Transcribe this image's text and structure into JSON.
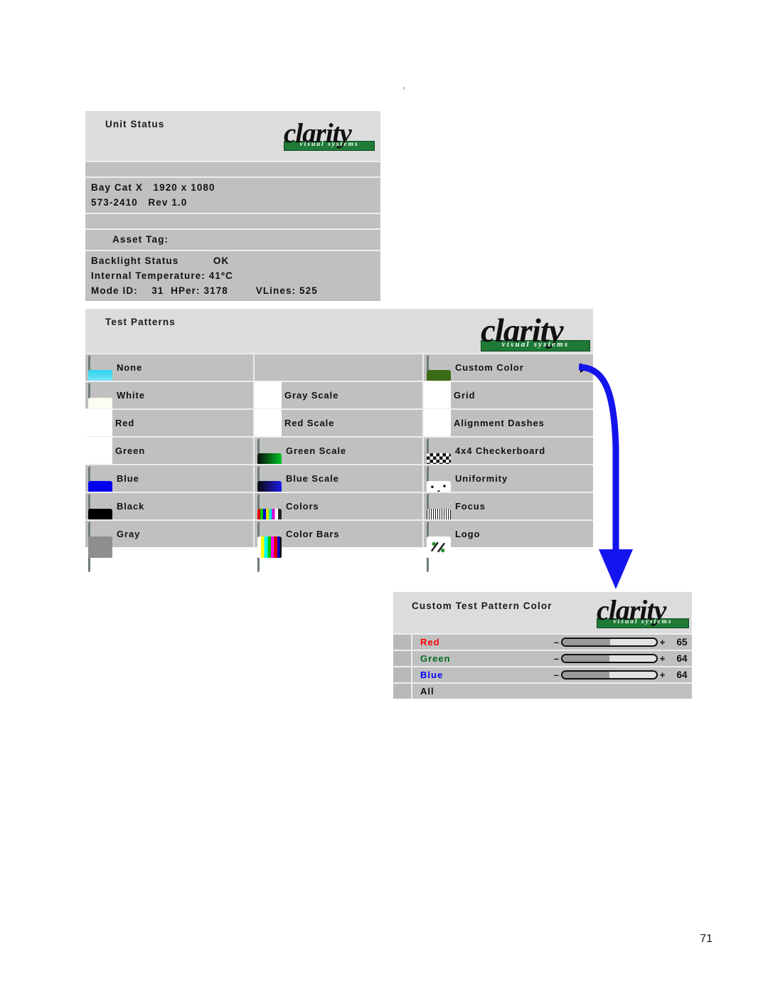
{
  "brand": {
    "word": "clarity",
    "tagline": "visual systems",
    "registered": "®"
  },
  "page": {
    "number": "71",
    "top_artifact": "ııı"
  },
  "unit_status": {
    "title": "Unit Status",
    "model_line": "Bay Cat X   1920 x 1080",
    "part_line": "573-2410   Rev 1.0",
    "asset_tag": "Asset Tag:",
    "backlight": "Backlight Status          OK",
    "temperature": "Internal Temperature: 41ºC",
    "mode_line": "Mode ID:    31  HPer: 3178        VLines: 525"
  },
  "test_patterns": {
    "title": "Test Patterns",
    "columns": [
      {
        "items": [
          {
            "label": "None",
            "icon": "photo-landscape-icon",
            "icon_style": "photo"
          },
          {
            "label": "White",
            "icon": "white-screen-icon",
            "icon_style": "solid",
            "color": "#fbfbf2"
          },
          {
            "label": "Red",
            "icon": "red-screen-icon",
            "icon_style": "blank"
          },
          {
            "label": "Green",
            "icon": "green-screen-icon",
            "icon_style": "blank"
          },
          {
            "label": "Blue",
            "icon": "blue-screen-icon",
            "icon_style": "solid",
            "color": "#0000ee"
          },
          {
            "label": "Black",
            "icon": "black-screen-icon",
            "icon_style": "solid",
            "color": "#000000"
          },
          {
            "label": "Gray",
            "icon": "gray-screen-icon",
            "icon_style": "solid",
            "color": "#8e8e8e"
          }
        ]
      },
      {
        "items": [
          {
            "label": "",
            "icon": "",
            "icon_style": "empty"
          },
          {
            "label": "Gray Scale",
            "icon": "gray-scale-icon",
            "icon_style": "blank"
          },
          {
            "label": "Red Scale",
            "icon": "red-scale-icon",
            "icon_style": "blank"
          },
          {
            "label": "Green Scale",
            "icon": "green-scale-icon",
            "icon_style": "grad",
            "color": "#00c425"
          },
          {
            "label": "Blue Scale",
            "icon": "blue-scale-icon",
            "icon_style": "grad",
            "color": "#1a1ae8"
          },
          {
            "label": "Colors",
            "icon": "colors-icon",
            "icon_style": "colors"
          },
          {
            "label": "Color Bars",
            "icon": "color-bars-icon",
            "icon_style": "bars"
          }
        ]
      },
      {
        "items": [
          {
            "label": "Custom Color",
            "icon": "custom-color-icon",
            "icon_style": "solid",
            "color": "#3c6b16",
            "has_arrow": true
          },
          {
            "label": "Grid",
            "icon": "grid-icon",
            "icon_style": "blank"
          },
          {
            "label": "Alignment Dashes",
            "icon": "alignment-dashes-icon",
            "icon_style": "blank"
          },
          {
            "label": "4x4 Checkerboard",
            "icon": "checkerboard-icon",
            "icon_style": "checker"
          },
          {
            "label": "Uniformity",
            "icon": "uniformity-icon",
            "icon_style": "dots"
          },
          {
            "label": "Focus",
            "icon": "focus-icon",
            "icon_style": "focus"
          },
          {
            "label": "Logo",
            "icon": "logo-pattern-icon",
            "icon_style": "logomark"
          }
        ]
      }
    ]
  },
  "custom_test_pattern_color": {
    "title": "Custom Test Pattern Color",
    "minus": "–",
    "plus": "+",
    "rows": [
      {
        "label": "Red",
        "color": "#ff0000",
        "value": "65",
        "percent": 51,
        "slider": true
      },
      {
        "label": "Green",
        "color": "#006b18",
        "value": "64",
        "percent": 50,
        "slider": true
      },
      {
        "label": "Blue",
        "color": "#0000ff",
        "value": "64",
        "percent": 50,
        "slider": true
      },
      {
        "label": "All",
        "color": "#111111",
        "value": "",
        "percent": 0,
        "slider": false
      }
    ]
  },
  "annotation": {
    "arrow_color": "#1414ee",
    "description": "curved-arrow-custom-color-to-panel"
  }
}
